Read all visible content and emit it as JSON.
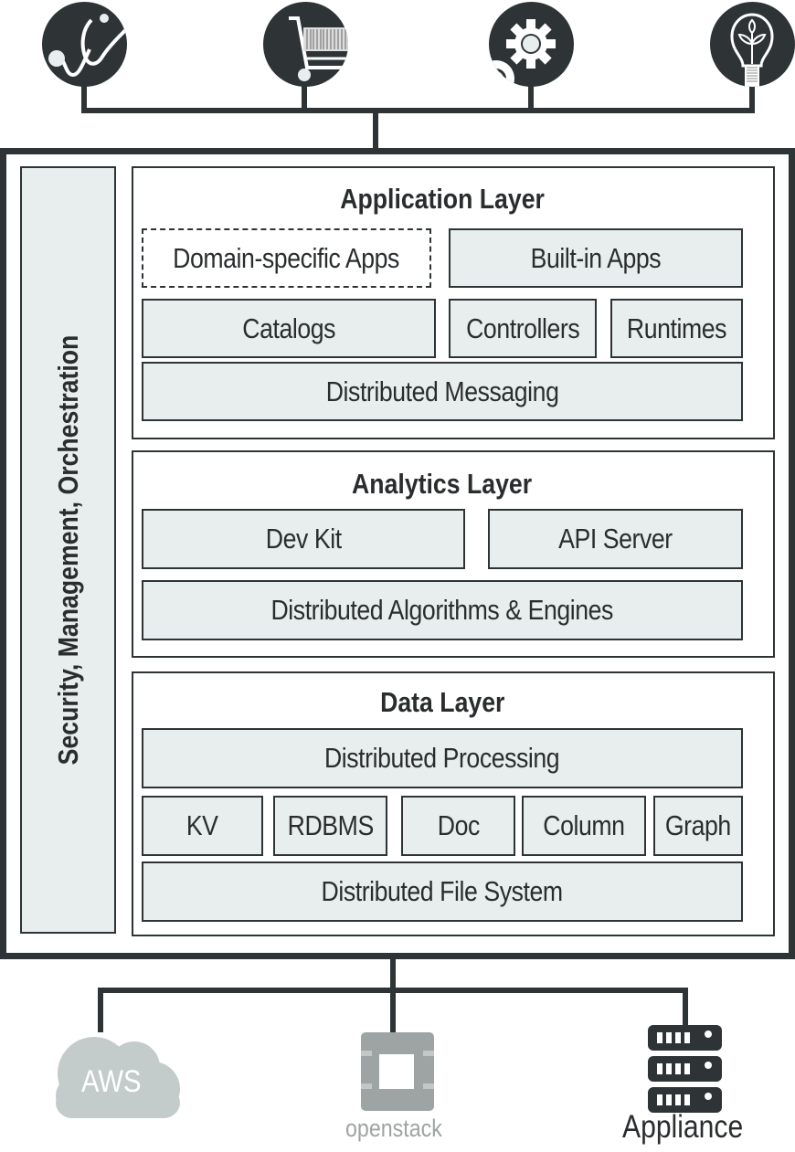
{
  "top_icons": [
    {
      "name": "stethoscope",
      "meaning": "healthcare"
    },
    {
      "name": "shopping-cart",
      "meaning": "retail"
    },
    {
      "name": "gears",
      "meaning": "industry"
    },
    {
      "name": "light-bulb-plant",
      "meaning": "energy"
    }
  ],
  "sidebar": {
    "label": "Security, Management, Orchestration"
  },
  "application_layer": {
    "title": "Application Layer",
    "domain_apps": "Domain-specific Apps",
    "builtin_apps": "Built-in Apps",
    "catalogs": "Catalogs",
    "controllers": "Controllers",
    "runtimes": "Runtimes",
    "messaging": "Distributed Messaging"
  },
  "analytics_layer": {
    "title": "Analytics Layer",
    "dev_kit": "Dev Kit",
    "api_server": "API Server",
    "algorithms": "Distributed Algorithms & Engines"
  },
  "data_layer": {
    "title": "Data Layer",
    "processing": "Distributed Processing",
    "stores": [
      "KV",
      "RDBMS",
      "Doc",
      "Column",
      "Graph"
    ],
    "file_system": "Distributed File System"
  },
  "deployments": {
    "aws": "AWS",
    "openstack": "openstack",
    "appliance": "Appliance"
  },
  "colors": {
    "dark": "#2e3436",
    "box_fill": "#e8eeee",
    "cloud": "#c4cccb",
    "openstack": "#9ea3a3"
  }
}
